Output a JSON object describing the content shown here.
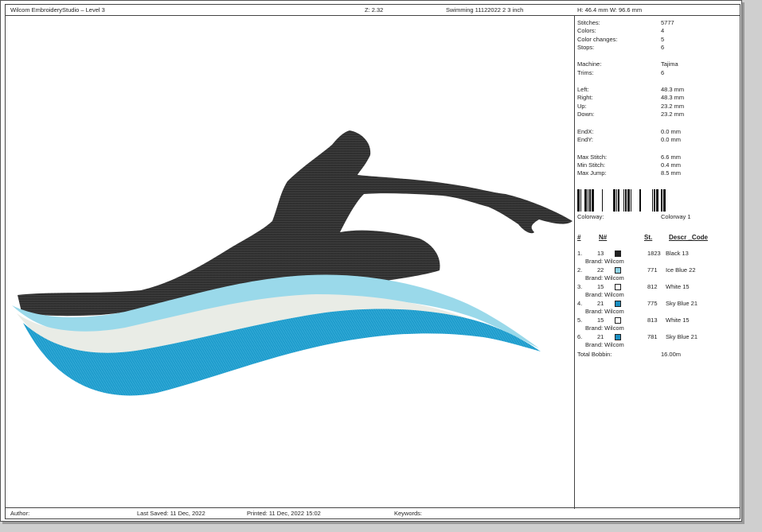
{
  "header": {
    "app": "Wilcom EmbroideryStudio – Level 3",
    "zoom": "Z: 2.32",
    "design": "Swimming 11122022 2 3 inch",
    "size": "H: 46.4 mm   W: 96.6 mm"
  },
  "stats": [
    {
      "k": "Stitches:",
      "v": "5777"
    },
    {
      "k": "Colors:",
      "v": "4"
    },
    {
      "k": "Color changes:",
      "v": "5"
    },
    {
      "k": "Stops:",
      "v": "6"
    },
    {
      "k": "Machine:",
      "v": "Tajima"
    },
    {
      "k": "Trims:",
      "v": "6"
    },
    {
      "k": "Left:",
      "v": "48.3 mm"
    },
    {
      "k": "Right:",
      "v": "48.3 mm"
    },
    {
      "k": "Up:",
      "v": "23.2 mm"
    },
    {
      "k": "Down:",
      "v": "23.2 mm"
    },
    {
      "k": "EndX:",
      "v": "0.0 mm"
    },
    {
      "k": "EndY:",
      "v": "0.0 mm"
    },
    {
      "k": "Max Stitch:",
      "v": "6.6 mm"
    },
    {
      "k": "Min Stitch:",
      "v": "0.4 mm"
    },
    {
      "k": "Max Jump:",
      "v": "8.5 mm"
    }
  ],
  "colorway": {
    "k": "Colorway:",
    "v": "Colorway 1"
  },
  "table": {
    "headers": {
      "idx": "#",
      "n": "N#",
      "st": "St.",
      "descr": "Descr _Code"
    },
    "rows": [
      {
        "idx": "1.",
        "n": "13",
        "color": "#222222",
        "st": "1823",
        "descr": "Black 13",
        "brand": "Brand: Wilcom"
      },
      {
        "idx": "2.",
        "n": "22",
        "color": "#8fd3e6",
        "st": "771",
        "descr": "Ice Blue 22",
        "brand": "Brand: Wilcom"
      },
      {
        "idx": "3.",
        "n": "15",
        "color": "#ffffff",
        "st": "812",
        "descr": "White 15",
        "brand": "Brand: Wilcom"
      },
      {
        "idx": "4.",
        "n": "21",
        "color": "#1a8fc2",
        "st": "775",
        "descr": "Sky Blue 21",
        "brand": "Brand: Wilcom"
      },
      {
        "idx": "5.",
        "n": "15",
        "color": "#ffffff",
        "st": "813",
        "descr": "White 15",
        "brand": "Brand: Wilcom"
      },
      {
        "idx": "6.",
        "n": "21",
        "color": "#1a8fc2",
        "st": "781",
        "descr": "Sky Blue 21",
        "brand": "Brand: Wilcom"
      }
    ]
  },
  "bobbin": {
    "k": "Total Bobbin:",
    "v": "16.00m"
  },
  "footer": {
    "author": "Author:",
    "saved": "Last Saved: 11 Dec, 2022",
    "printed": "Printed: 11 Dec, 2022 15:02",
    "keywords": "Keywords:"
  },
  "colors": {
    "swimmer": "#2f2f2f",
    "wave_dark": "#1f9ccc",
    "wave_white": "#e9ece6",
    "wave_light": "#9ad9ea"
  }
}
